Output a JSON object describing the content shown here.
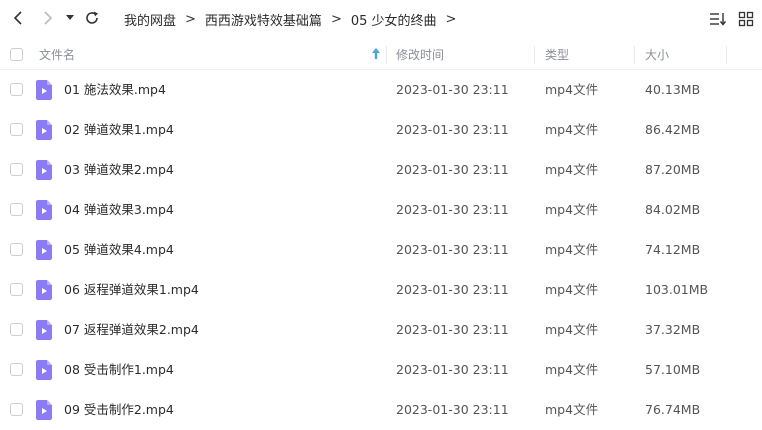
{
  "toolbar": {
    "back_icon": "chevron-left-icon",
    "forward_icon": "chevron-right-icon",
    "history_icon": "caret-down-icon",
    "refresh_icon": "refresh-icon",
    "sort_icon": "sort-lines-icon",
    "grid_icon": "grid-view-icon"
  },
  "breadcrumb": {
    "items": [
      "我的网盘",
      "西西游戏特效基础篇",
      "05 少女的终曲"
    ],
    "separator": ">"
  },
  "table": {
    "columns": {
      "name": "文件名",
      "modified": "修改时间",
      "type": "类型",
      "size": "大小"
    },
    "sort_indicator_color": "#4aa8d8",
    "rows": [
      {
        "name": "01 施法效果.mp4",
        "modified": "2023-01-30 23:11",
        "type": "mp4文件",
        "size": "40.13MB"
      },
      {
        "name": "02 弹道效果1.mp4",
        "modified": "2023-01-30 23:11",
        "type": "mp4文件",
        "size": "86.42MB"
      },
      {
        "name": "03 弹道效果2.mp4",
        "modified": "2023-01-30 23:11",
        "type": "mp4文件",
        "size": "87.20MB"
      },
      {
        "name": "04 弹道效果3.mp4",
        "modified": "2023-01-30 23:11",
        "type": "mp4文件",
        "size": "84.02MB"
      },
      {
        "name": "05 弹道效果4.mp4",
        "modified": "2023-01-30 23:11",
        "type": "mp4文件",
        "size": "74.12MB"
      },
      {
        "name": "06 返程弹道效果1.mp4",
        "modified": "2023-01-30 23:11",
        "type": "mp4文件",
        "size": "103.01MB"
      },
      {
        "name": "07 返程弹道效果2.mp4",
        "modified": "2023-01-30 23:11",
        "type": "mp4文件",
        "size": "37.32MB"
      },
      {
        "name": "08 受击制作1.mp4",
        "modified": "2023-01-30 23:11",
        "type": "mp4文件",
        "size": "57.10MB"
      },
      {
        "name": "09 受击制作2.mp4",
        "modified": "2023-01-30 23:11",
        "type": "mp4文件",
        "size": "76.74MB"
      }
    ]
  },
  "colors": {
    "file_icon": "#8b7cf6",
    "file_icon_fold": "#b9aefc"
  }
}
